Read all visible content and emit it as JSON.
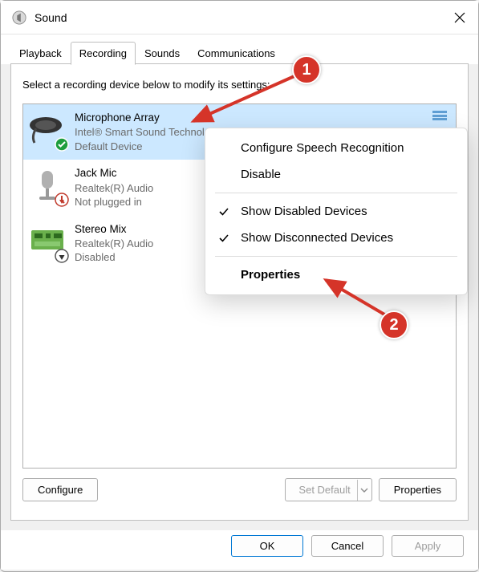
{
  "window": {
    "title": "Sound"
  },
  "close_label": "Close",
  "tabs": {
    "playback": "Playback",
    "recording": "Recording",
    "sounds": "Sounds",
    "communications": "Communications",
    "active": "Recording"
  },
  "instruction": "Select a recording device below to modify its settings:",
  "devices": [
    {
      "name": "Microphone Array",
      "sub1": "Intel® Smart Sound Technology",
      "sub2": "Default Device",
      "badge": "ok",
      "selected": true
    },
    {
      "name": "Jack Mic",
      "sub1": "Realtek(R) Audio",
      "sub2": "Not plugged in",
      "badge": "unplugged"
    },
    {
      "name": "Stereo Mix",
      "sub1": "Realtek(R) Audio",
      "sub2": "Disabled",
      "badge": "disabled"
    }
  ],
  "context_menu": {
    "configure_speech": "Configure Speech Recognition",
    "disable": "Disable",
    "show_disabled": "Show Disabled Devices",
    "show_disconnected": "Show Disconnected Devices",
    "properties": "Properties"
  },
  "buttons": {
    "configure": "Configure",
    "set_default": "Set Default",
    "properties": "Properties",
    "ok": "OK",
    "cancel": "Cancel",
    "apply": "Apply"
  },
  "annotations": {
    "badge1": "1",
    "badge2": "2"
  }
}
